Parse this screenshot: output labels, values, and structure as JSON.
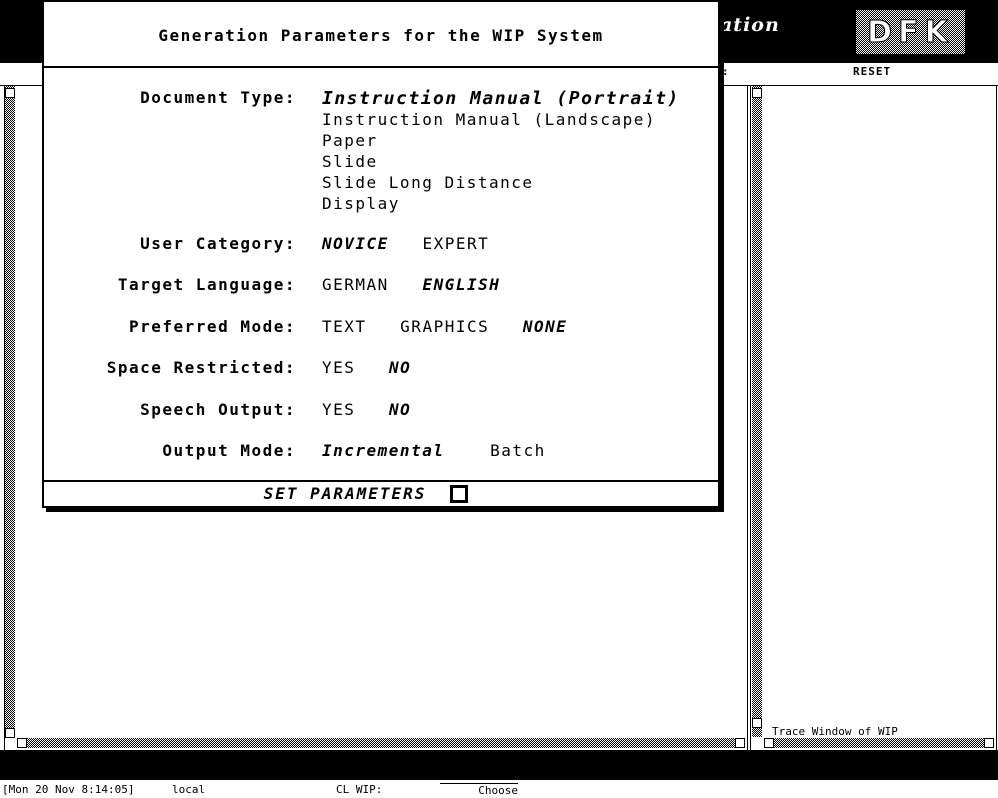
{
  "header": {
    "title_fragment": "ation",
    "logo_text": "DFK",
    "reset_label": "RESET",
    "col_fragment": ":"
  },
  "dialog": {
    "title": "Generation Parameters for the WIP System",
    "document_type": {
      "label": "Document Type:",
      "options": [
        "Instruction Manual (Portrait)",
        "Instruction Manual (Landscape)",
        "Paper",
        "Slide",
        "Slide Long Distance",
        "Display"
      ],
      "selected": "Instruction Manual (Portrait)"
    },
    "user_category": {
      "label": "User Category:",
      "options": [
        "NOVICE",
        "EXPERT"
      ],
      "selected": "NOVICE"
    },
    "target_language": {
      "label": "Target Language:",
      "options": [
        "GERMAN",
        "ENGLISH"
      ],
      "selected": "ENGLISH"
    },
    "preferred_mode": {
      "label": "Preferred Mode:",
      "options": [
        "TEXT",
        "GRAPHICS",
        "NONE"
      ],
      "selected": "NONE"
    },
    "space_restricted": {
      "label": "Space Restricted:",
      "options": [
        "YES",
        "NO"
      ],
      "selected": "NO"
    },
    "speech_output": {
      "label": "Speech Output:",
      "options": [
        "YES",
        "NO"
      ],
      "selected": "NO"
    },
    "output_mode": {
      "label": "Output Mode:",
      "options": [
        "Incremental",
        "Batch"
      ],
      "selected": "Incremental"
    },
    "set_parameters_label": "SET PARAMETERS"
  },
  "trace_window": {
    "label": "Trace Window of WIP"
  },
  "status_bar": {
    "datetime": "[Mon 20 Nov 8:14:05]",
    "host": "local",
    "package": "CL WIP:",
    "mode": "Choose"
  }
}
